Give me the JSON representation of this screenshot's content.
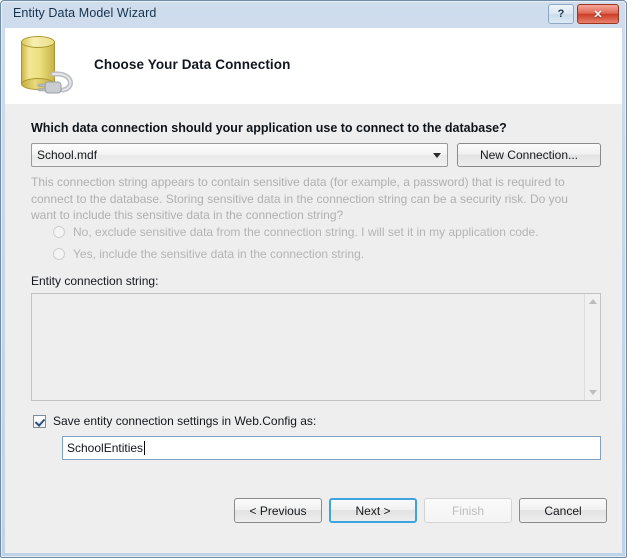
{
  "window": {
    "title": "Entity Data Model Wizard",
    "help_button": "?",
    "close_button": "✕"
  },
  "header": {
    "title": "Choose Your Data Connection",
    "icon": "database-with-plug-icon"
  },
  "main": {
    "question": "Which data connection should your application use to connect to the database?",
    "connection_combo": {
      "value": "School.mdf",
      "arrow_icon": "chevron-down-icon"
    },
    "new_connection_button": "New Connection...",
    "sensitive_data_note": "This connection string appears to contain sensitive data (for example, a password) that is required to connect to the database. Storing sensitive data in the connection string can be a security risk. Do you want to include this sensitive data in the connection string?",
    "radio_options": [
      {
        "label": "No, exclude sensitive data from the connection string. I will set it in my application code.",
        "selected": false,
        "enabled": false
      },
      {
        "label": "Yes, include the sensitive data in the connection string.",
        "selected": false,
        "enabled": false
      }
    ],
    "entity_connection_string_label": "Entity connection string:",
    "entity_connection_string_value": "",
    "scrollbar": {
      "up_icon": "scroll-up-arrow-icon",
      "down_icon": "scroll-down-arrow-icon"
    },
    "save_settings_checkbox": {
      "label": "Save entity connection settings in Web.Config as:",
      "checked": true
    },
    "settings_name_input": {
      "value": "SchoolEntities",
      "placeholder": ""
    }
  },
  "footer": {
    "previous_button": "< Previous",
    "next_button": "Next >",
    "finish_button": "Finish",
    "cancel_button": "Cancel"
  },
  "colors": {
    "titlebar": "#c6d7ea",
    "body": "#efeeee",
    "default_button_outline": "#3fa3e0",
    "close_button": "#cc3c26",
    "disabled_text": "#b0b0b0"
  }
}
